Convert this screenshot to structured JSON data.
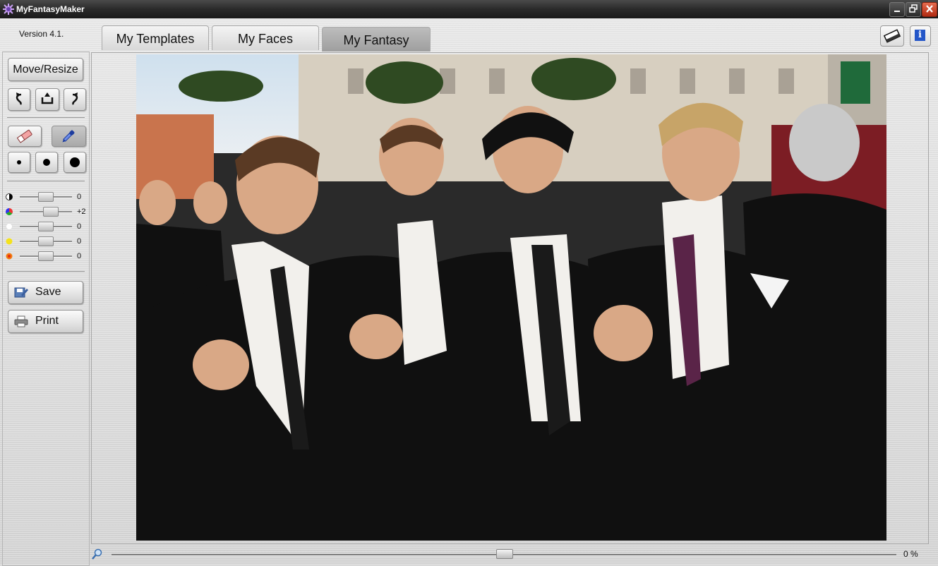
{
  "window": {
    "title": "MyFantasyMaker"
  },
  "version": "Version 4.1.",
  "tabs": [
    {
      "label": "My Templates"
    },
    {
      "label": "My Faces"
    },
    {
      "label": "My Fantasy",
      "selected": true
    }
  ],
  "tools": {
    "move_resize": "Move/Resize",
    "save": "Save",
    "print": "Print"
  },
  "adjustments": [
    {
      "icon": "contrast-icon",
      "value": "0",
      "level": 0.5
    },
    {
      "icon": "color-wheel-icon",
      "value": "+2",
      "level": 0.6
    },
    {
      "icon": "brightness-icon",
      "value": "0",
      "level": 0.5
    },
    {
      "icon": "yellow-tone-icon",
      "value": "0",
      "level": 0.5
    },
    {
      "icon": "warm-tone-icon",
      "value": "0",
      "level": 0.5
    }
  ],
  "zoom": {
    "value": "0 %",
    "level": 0.5
  },
  "colors": {
    "title_bar": "#2a2a2a",
    "close_button": "#c8381c",
    "info_blue": "#2456c8"
  }
}
